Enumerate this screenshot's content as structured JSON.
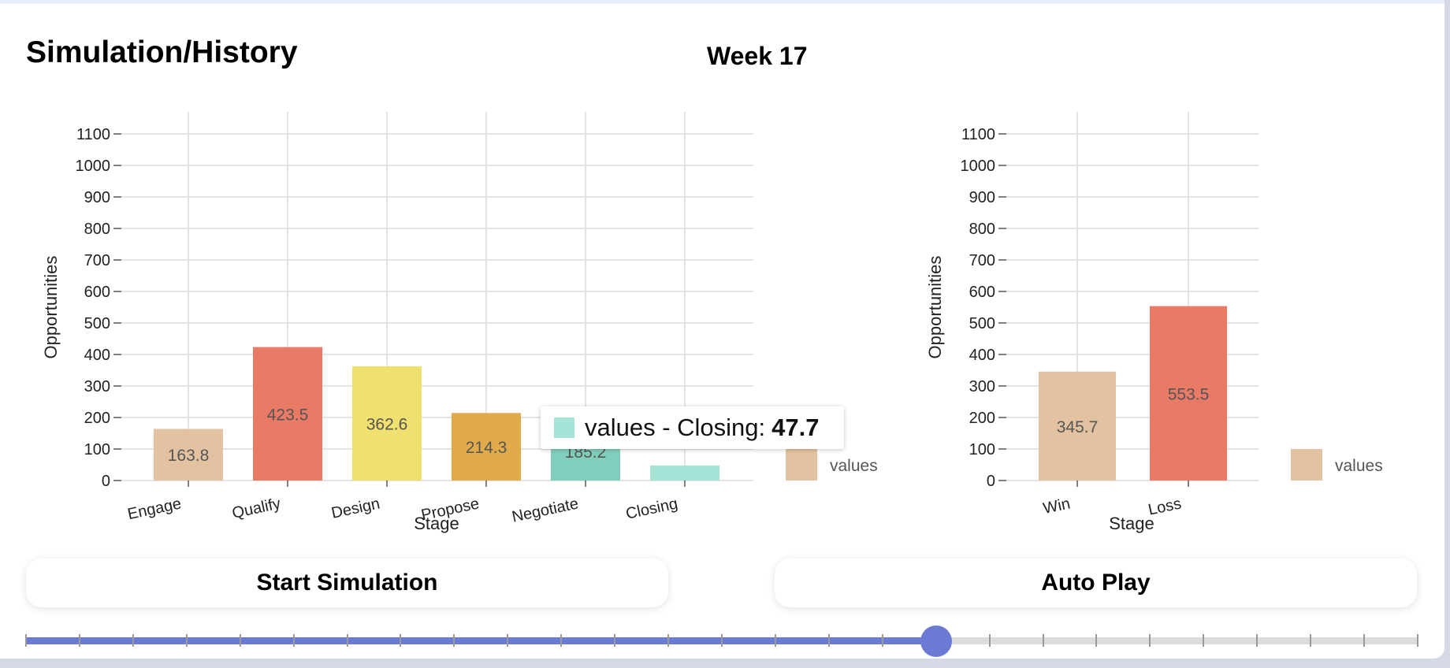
{
  "title": "Simulation/History",
  "week_label": "Week 17",
  "colors": {
    "accent": "#6b7bd3",
    "engage": "#e2c2a0",
    "qualify": "#e87a66",
    "design": "#efe070",
    "propose": "#e1ab4c",
    "negotiate": "#80cfbd",
    "closing": "#a6e3d7"
  },
  "chart_data": [
    {
      "type": "bar",
      "categories": [
        "Engage",
        "Qualify",
        "Design",
        "Propose",
        "Negotiate",
        "Closing"
      ],
      "values": [
        163.8,
        423.5,
        362.6,
        214.3,
        185.2,
        47.7
      ],
      "value_labels": [
        "163.8",
        "423.5",
        "362.6",
        "214.3",
        "185.2",
        ""
      ],
      "colors": [
        "#e2c2a0",
        "#e87a66",
        "#efe070",
        "#e1ab4c",
        "#80cfbd",
        "#a6e3d7"
      ],
      "xlabel": "Stage",
      "ylabel": "Opportunities",
      "ylim": [
        0,
        1100
      ],
      "yticks": [
        0,
        100,
        200,
        300,
        400,
        500,
        600,
        700,
        800,
        900,
        1000,
        1100
      ],
      "legend": "values",
      "legend_position": "right",
      "grid": true
    },
    {
      "type": "bar",
      "categories": [
        "Win",
        "Loss"
      ],
      "values": [
        345.7,
        553.5
      ],
      "value_labels": [
        "345.7",
        "553.5"
      ],
      "colors": [
        "#e2c2a0",
        "#e87a66"
      ],
      "xlabel": "Stage",
      "ylabel": "Opportunities",
      "ylim": [
        0,
        1100
      ],
      "yticks": [
        0,
        100,
        200,
        300,
        400,
        500,
        600,
        700,
        800,
        900,
        1000,
        1100
      ],
      "legend": "values",
      "legend_position": "right",
      "grid": true
    }
  ],
  "tooltip": {
    "text": "values - Closing:",
    "value": "47.7",
    "color": "#a6e3d7"
  },
  "buttons": {
    "start_label": "Start Simulation",
    "autoplay_label": "Auto Play"
  },
  "slider": {
    "current_step": 17,
    "total_steps": 26
  }
}
